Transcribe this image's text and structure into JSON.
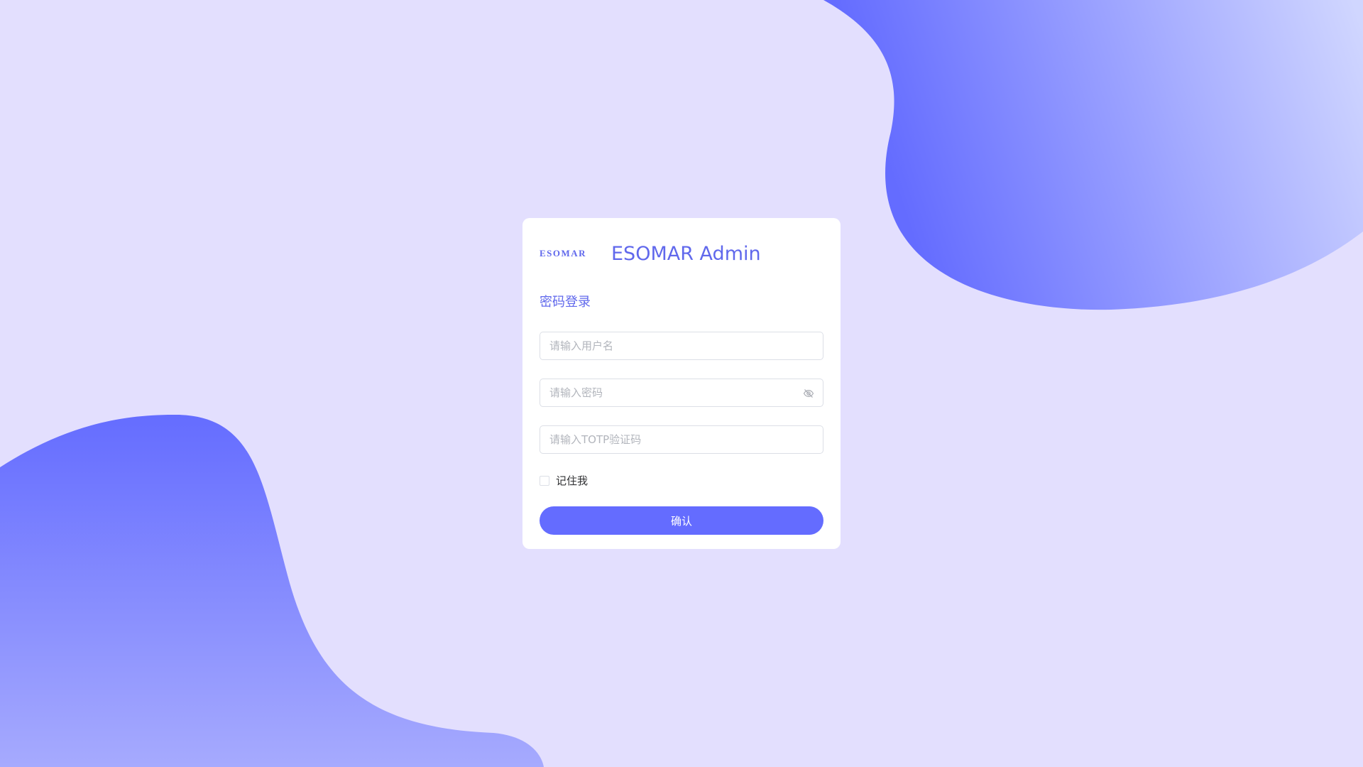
{
  "app": {
    "logo_text": "ESOMAR",
    "title": "ESOMAR Admin"
  },
  "login": {
    "section_title": "密码登录",
    "username_placeholder": "请输入用户名",
    "password_placeholder": "请输入密码",
    "totp_placeholder": "请输入TOTP验证码",
    "remember_label": "记住我",
    "remember_checked": false,
    "submit_label": "确认"
  },
  "icons": {
    "password_toggle": "eye-off-icon"
  },
  "colors": {
    "background": "#e3dffe",
    "accent": "#646cff",
    "brand_text": "#6068ec",
    "blob_dark": "#646cff",
    "blob_light": "#d0d6ff"
  }
}
